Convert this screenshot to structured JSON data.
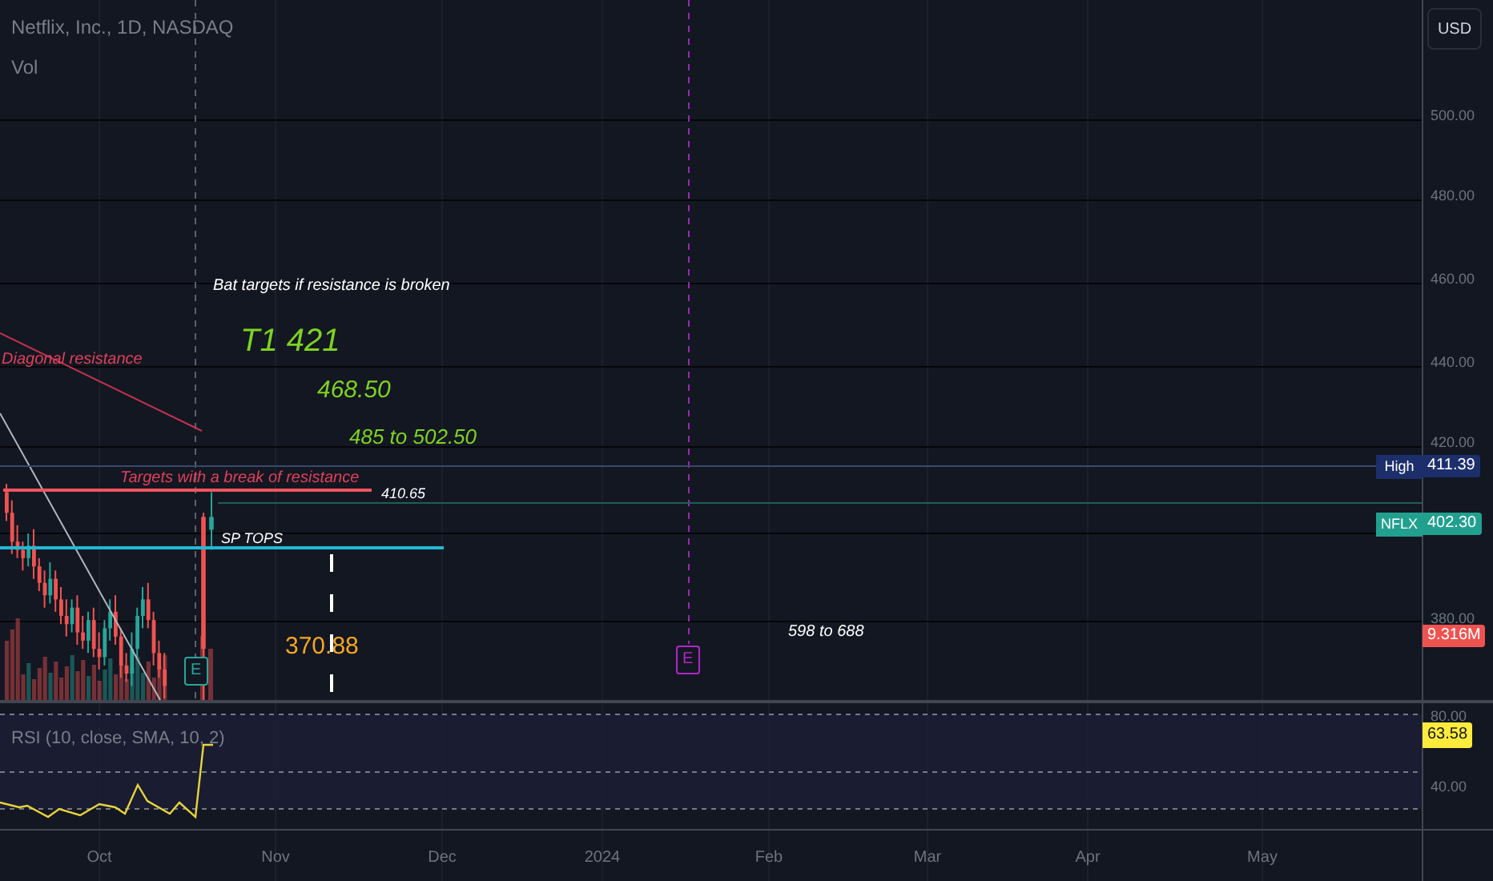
{
  "chart": {
    "title": "Netflix, Inc., 1D, NASDAQ",
    "indicator": "Vol"
  },
  "currency_button": "USD",
  "price_axis": [
    "500.00",
    "480.00",
    "460.00",
    "440.00",
    "420.00",
    "380.00"
  ],
  "price_tags": [
    {
      "label": "High",
      "value": "411.39",
      "color": "#1c2f6b"
    },
    {
      "label": "NFLX",
      "value": "402.30",
      "color": "#22a08f"
    },
    {
      "value": "9.316M",
      "color": "#ef5350"
    }
  ],
  "annotations": [
    {
      "text": "Bat targets if resistance is broken",
      "color": "#ffffff"
    },
    {
      "text": "T1 421",
      "color": "#7ed321"
    },
    {
      "text": "468.50",
      "color": "#7ed321"
    },
    {
      "text": "485 to 502.50",
      "color": "#7ed321"
    },
    {
      "text": "Diagonal resistance",
      "color": "#e0405a"
    },
    {
      "text": "Targets with a break of resistance",
      "color": "#e0405a"
    },
    {
      "text": "410.65",
      "color": "#ffffff"
    },
    {
      "text": "SP TOPS",
      "color": "#ffffff"
    },
    {
      "text": "370.88",
      "color": "#f5a623"
    },
    {
      "text": "598 to 688",
      "color": "#ffffff"
    }
  ],
  "events": [
    {
      "label": "E",
      "color": "#26a69a"
    },
    {
      "label": "E",
      "color": "#b026c9"
    }
  ],
  "rsi": {
    "label": "RSI (10, close, SMA, 10, 2)",
    "value": "63.58",
    "axis": [
      "80.00",
      "40.00"
    ]
  },
  "time_axis": [
    "Oct",
    "Nov",
    "Dec",
    "2024",
    "Feb",
    "Mar",
    "Apr",
    "May"
  ]
}
